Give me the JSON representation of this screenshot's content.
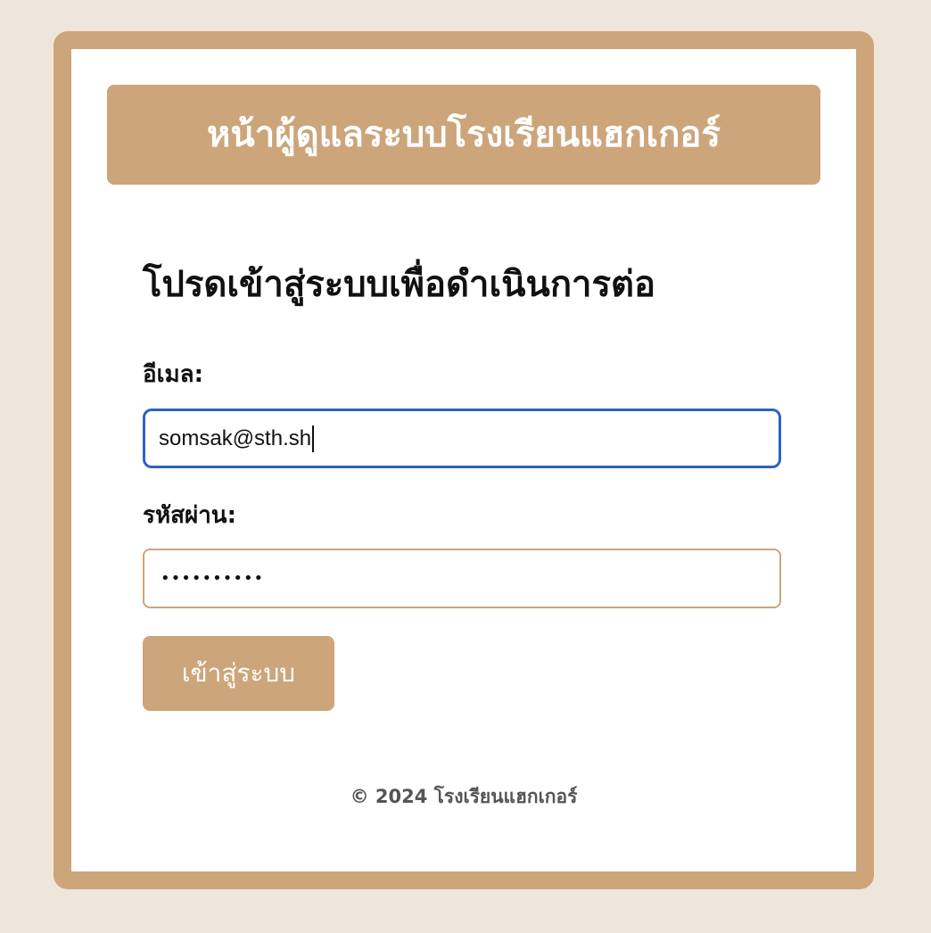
{
  "header": {
    "title": "หน้าผู้ดูแลระบบโรงเรียนแฮกเกอร์"
  },
  "login": {
    "heading": "โปรดเข้าสู่ระบบเพื่อดำเนินการต่อ",
    "email_label": "อีเมล:",
    "email_value": "somsak@sth.sh",
    "password_label": "รหัสผ่าน:",
    "password_mask": "••••••••••",
    "submit_label": "เข้าสู่ระบบ"
  },
  "footer": {
    "text": "© 2024 โรงเรียนแฮกเกอร์"
  },
  "colors": {
    "background": "#efe6db",
    "accent": "#cca57a",
    "focus_border": "#2f62c3"
  }
}
